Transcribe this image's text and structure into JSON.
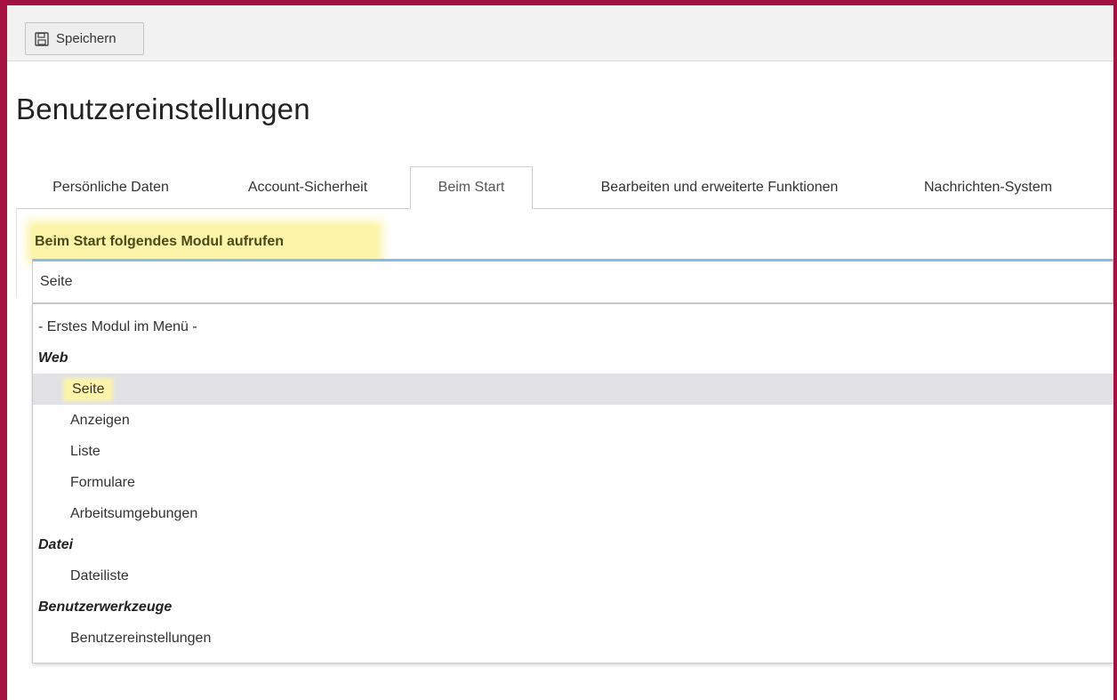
{
  "toolbar": {
    "save_label": "Speichern",
    "save_icon": "save-icon"
  },
  "page": {
    "title": "Benutzereinstellungen"
  },
  "tabs": [
    {
      "label": "Persönliche Daten",
      "active": false
    },
    {
      "label": "Account-Sicherheit",
      "active": false
    },
    {
      "label": "Beim Start",
      "active": true
    },
    {
      "label": "Bearbeiten und erweiterte Funktionen",
      "active": false
    },
    {
      "label": "Nachrichten-System",
      "active": false
    }
  ],
  "field": {
    "label": "Beim Start folgendes Modul aufrufen",
    "selected_value": "Seite"
  },
  "dropdown": {
    "options": [
      {
        "label": "- Erstes Modul im Menü -",
        "type": "option"
      },
      {
        "label": "Web",
        "type": "group"
      },
      {
        "label": "Seite",
        "type": "option",
        "selected": true
      },
      {
        "label": "Anzeigen",
        "type": "option"
      },
      {
        "label": "Liste",
        "type": "option"
      },
      {
        "label": "Formulare",
        "type": "option"
      },
      {
        "label": "Arbeitsumgebungen",
        "type": "option"
      },
      {
        "label": "Datei",
        "type": "group"
      },
      {
        "label": "Dateiliste",
        "type": "option"
      },
      {
        "label": "Benutzerwerkzeuge",
        "type": "group"
      },
      {
        "label": "Benutzereinstellungen",
        "type": "option"
      }
    ]
  },
  "colors": {
    "frame": "#a51140",
    "highlight": "#fbf4a9",
    "focus_border": "#8bbbe5",
    "selected_row": "#e2e2e6"
  }
}
